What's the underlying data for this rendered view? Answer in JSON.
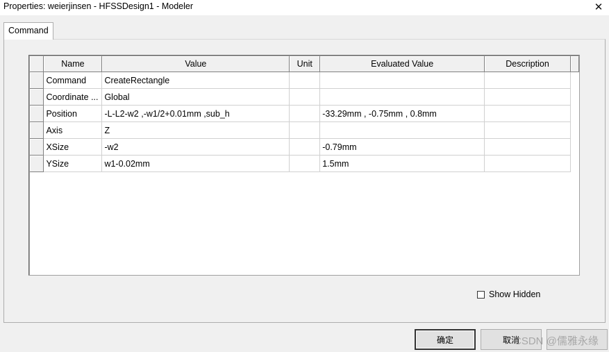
{
  "window": {
    "title": "Properties: weierjinsen - HFSSDesign1 - Modeler",
    "close_glyph": "✕"
  },
  "tabs": [
    {
      "label": "Command",
      "active": true
    }
  ],
  "grid": {
    "columns": [
      "Name",
      "Value",
      "Unit",
      "Evaluated Value",
      "Description"
    ],
    "rows": [
      {
        "name": "Command",
        "value": "CreateRectangle",
        "unit": "",
        "evaluated": "",
        "description": ""
      },
      {
        "name": "Coordinate ...",
        "value": "Global",
        "unit": "",
        "evaluated": "",
        "description": ""
      },
      {
        "name": "Position",
        "value": "-L-L2-w2 ,-w1/2+0.01mm ,sub_h",
        "unit": "",
        "evaluated": "-33.29mm , -0.75mm , 0.8mm",
        "description": ""
      },
      {
        "name": "Axis",
        "value": "Z",
        "unit": "",
        "evaluated": "",
        "description": ""
      },
      {
        "name": "XSize",
        "value": "-w2",
        "unit": "",
        "evaluated": "-0.79mm",
        "description": ""
      },
      {
        "name": "YSize",
        "value": "w1-0.02mm",
        "unit": "",
        "evaluated": "1.5mm",
        "description": ""
      }
    ]
  },
  "show_hidden": {
    "label": "Show Hidden",
    "checked": false
  },
  "buttons": {
    "ok": "确定",
    "cancel": "取消"
  },
  "watermark": "CSDN @儒雅永缘"
}
